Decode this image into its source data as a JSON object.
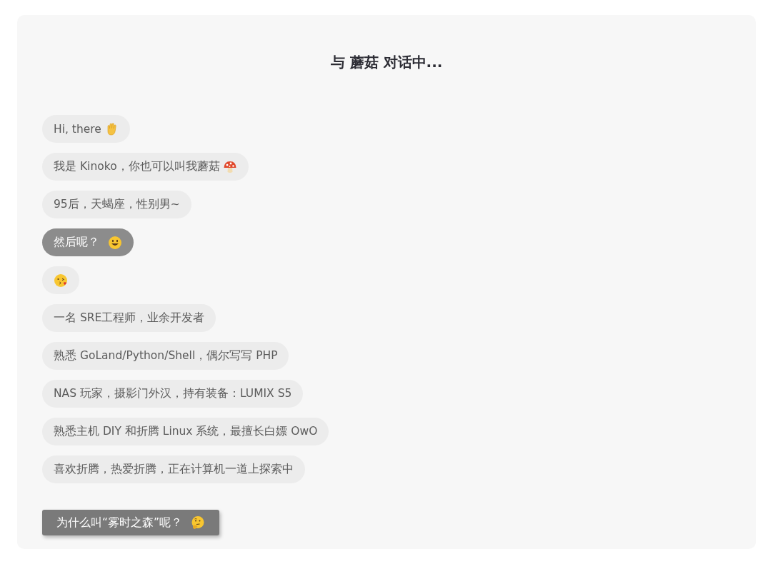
{
  "title": "与 蘑菇 对话中...",
  "messages": [
    {
      "kind": "incoming",
      "text": "Hi, there"
    },
    {
      "kind": "incoming",
      "text": "我是 Kinoko，你也可以叫我蘑菇"
    },
    {
      "kind": "incoming",
      "text": "95后，天蝎座，性别男~"
    },
    {
      "kind": "reply",
      "text": "然后呢？"
    },
    {
      "kind": "emoji"
    },
    {
      "kind": "incoming",
      "text": "一名 SRE工程师，业余开发者"
    },
    {
      "kind": "incoming",
      "text": "熟悉 GoLand/Python/Shell，偶尔写写 PHP"
    },
    {
      "kind": "incoming",
      "text": "NAS 玩家，摄影门外汉，持有装备：LUMIX S5"
    },
    {
      "kind": "incoming",
      "text": "熟悉主机 DIY 和折腾 Linux 系统，最擅长白嫖 OwO"
    },
    {
      "kind": "incoming",
      "text": "喜欢折腾，热爱折腾，正在计算机一道上探索中"
    }
  ],
  "button": {
    "text": "为什么叫“雾时之森”呢？"
  }
}
